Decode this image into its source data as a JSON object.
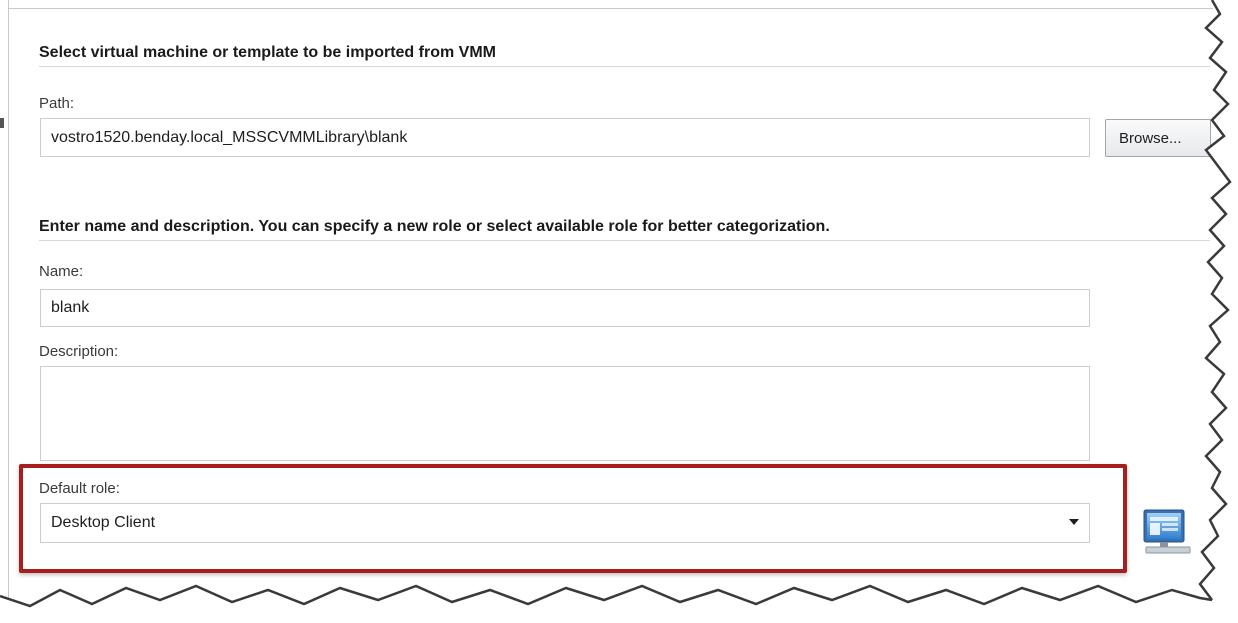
{
  "import_section": {
    "title": "Select virtual machine or template to be imported from VMM",
    "path_label": "Path:",
    "path_value": "vostro1520.benday.local_MSSCVMMLibrary\\blank",
    "browse_label": "Browse..."
  },
  "details_section": {
    "title": "Enter name and description. You can specify a new role or select available role for better categorization.",
    "name_label": "Name:",
    "name_value": "blank",
    "description_label": "Description:",
    "description_value": ""
  },
  "role_section": {
    "label": "Default role:",
    "selected": "Desktop Client",
    "icon": "computer-icon"
  },
  "colors": {
    "highlight": "#a81d1d",
    "border": "#c9ced6"
  }
}
